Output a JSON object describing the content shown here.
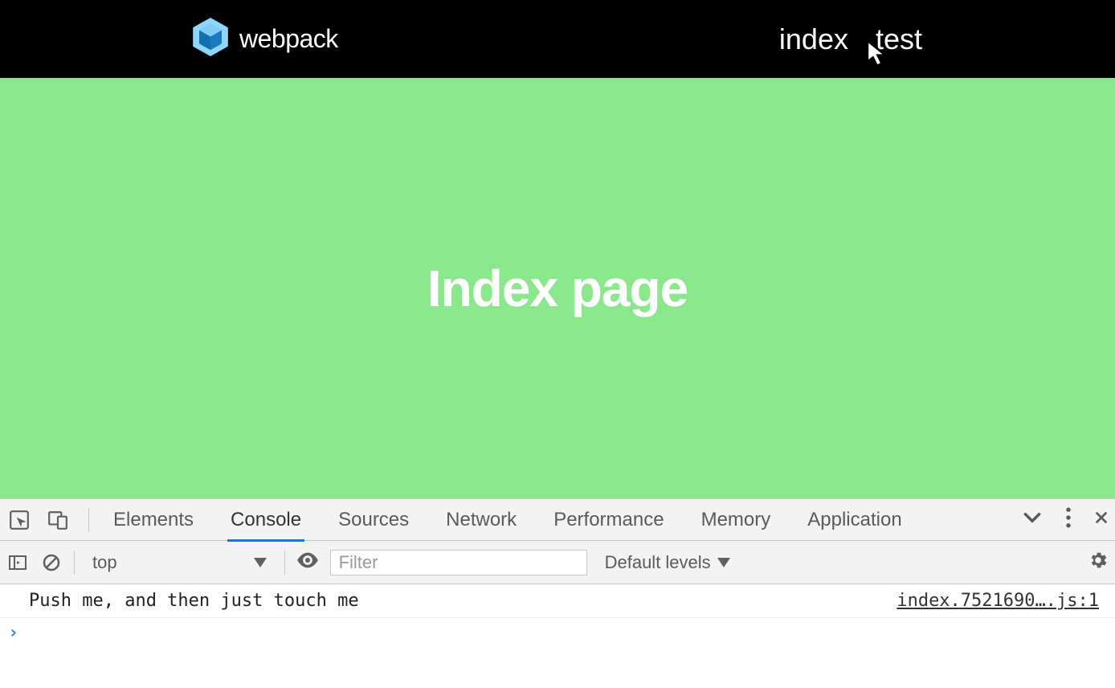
{
  "header": {
    "brand": "webpack",
    "nav": [
      "index",
      "test"
    ]
  },
  "hero": {
    "title": "Index page"
  },
  "devtools": {
    "tabs": [
      "Elements",
      "Console",
      "Sources",
      "Network",
      "Performance",
      "Memory",
      "Application"
    ],
    "active_tab": "Console",
    "toolbar": {
      "context": "top",
      "filter_placeholder": "Filter",
      "levels_label": "Default levels"
    },
    "console": {
      "message": "Push me, and then just touch me",
      "source": "index.7521690….js:1",
      "prompt": "›"
    }
  }
}
